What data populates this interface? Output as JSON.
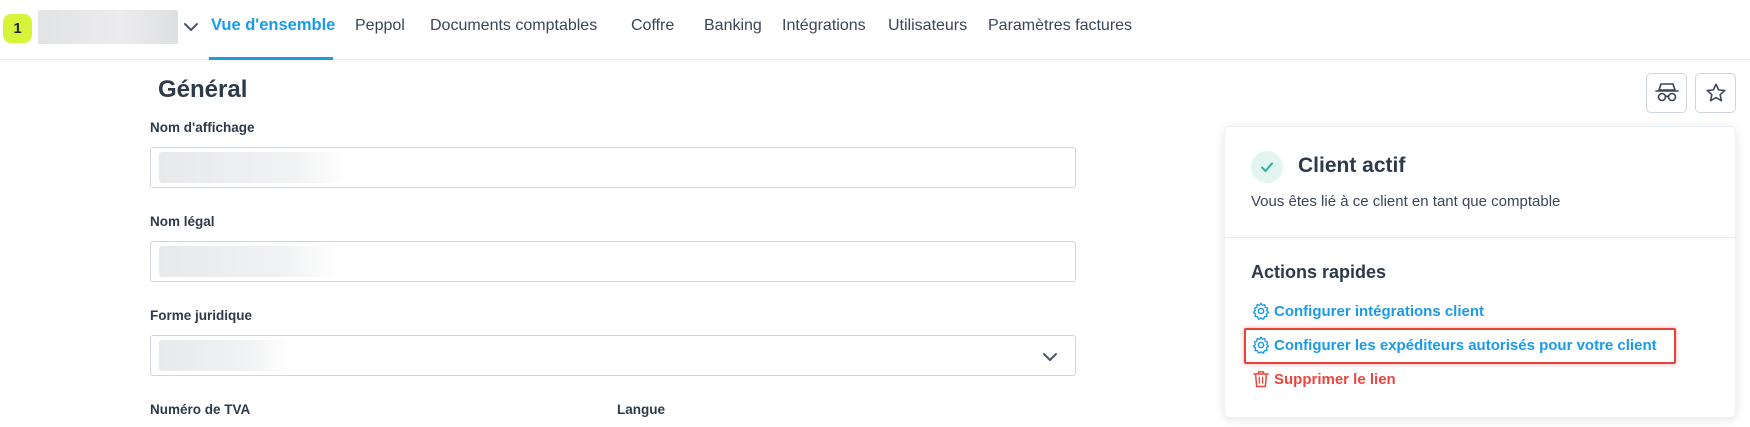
{
  "nav": {
    "badge": "1",
    "items": [
      {
        "label": "Vue d'ensemble",
        "active": true
      },
      {
        "label": "Peppol"
      },
      {
        "label": "Documents comptables"
      },
      {
        "label": "Coffre"
      },
      {
        "label": "Banking"
      },
      {
        "label": "Intégrations"
      },
      {
        "label": "Utilisateurs"
      },
      {
        "label": "Paramètres factures"
      }
    ]
  },
  "form": {
    "title": "Général",
    "fields": {
      "display_name_label": "Nom d'affichage",
      "legal_name_label": "Nom légal",
      "legal_form_label": "Forme juridique",
      "vat_label": "Numéro de TVA",
      "language_label": "Langue"
    }
  },
  "status_card": {
    "title": "Client actif",
    "subtitle": "Vous êtes lié à ce client en tant que comptable",
    "quick_actions_title": "Actions rapides",
    "actions": [
      {
        "label": "Configurer intégrations client",
        "icon": "gear-icon",
        "color": "#1a9be6"
      },
      {
        "label": "Configurer les expéditeurs autorisés pour votre client",
        "icon": "gear-icon",
        "color": "#1a9be6",
        "highlighted": true
      },
      {
        "label": "Supprimer le lien",
        "icon": "trash-icon",
        "color": "#e8463f"
      }
    ]
  },
  "toolbar": {
    "icons": [
      "incognito-icon",
      "star-icon"
    ]
  },
  "colors": {
    "accent": "#1a9be6",
    "badge": "#d7f33a",
    "danger": "#e8463f",
    "success_bg": "#e3f5f1",
    "success": "#2bb39a"
  }
}
